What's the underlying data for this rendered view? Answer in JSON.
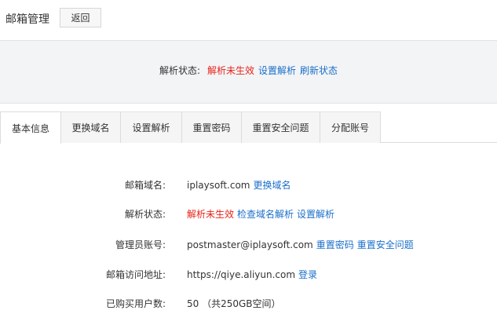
{
  "header": {
    "title": "邮箱管理",
    "back_label": "返回"
  },
  "status_band": {
    "label": "解析状态:",
    "status": "解析未生效",
    "set_dns": "设置解析",
    "refresh": "刷新状态"
  },
  "tabs": [
    {
      "label": "基本信息"
    },
    {
      "label": "更换域名"
    },
    {
      "label": "设置解析"
    },
    {
      "label": "重置密码"
    },
    {
      "label": "重置安全问题"
    },
    {
      "label": "分配账号"
    }
  ],
  "info": {
    "domain": {
      "key": "邮箱域名:",
      "value": "iplaysoft.com",
      "action": "更换域名"
    },
    "dns": {
      "key": "解析状态:",
      "status": "解析未生效",
      "check": "检查域名解析",
      "set": "设置解析"
    },
    "admin": {
      "key": "管理员账号:",
      "value": "postmaster@iplaysoft.com",
      "reset_pwd": "重置密码",
      "reset_question": "重置安全问题"
    },
    "url": {
      "key": "邮箱访问地址:",
      "value": "https://qiye.aliyun.com",
      "login": "登录"
    },
    "users": {
      "key": "已购买用户数:",
      "value": "50 （共250GB空间）"
    }
  },
  "colors": {
    "link": "#1a6fc9",
    "error": "#e8231a",
    "band": "#f3f4f6"
  }
}
